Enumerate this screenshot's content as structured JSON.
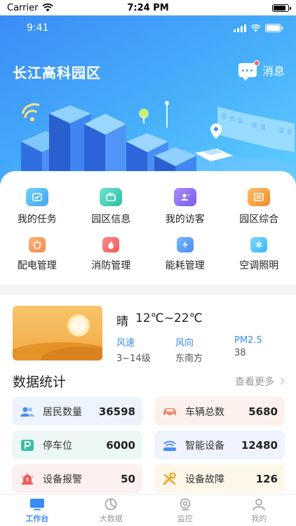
{
  "ios_status": {
    "carrier": "Carrier",
    "time": "7:24 PM"
  },
  "header": {
    "inner_time": "9:41",
    "title": "长江高科园区",
    "message_label": "消息"
  },
  "quick_menu": [
    {
      "label": "我的任务",
      "icon": "task-icon",
      "color": "#3fa7ec"
    },
    {
      "label": "园区信息",
      "icon": "park-info-icon",
      "color": "#2fbfa6"
    },
    {
      "label": "我的访客",
      "icon": "visitor-icon",
      "color": "#7a5af0"
    },
    {
      "label": "园区综合",
      "icon": "park-general-icon",
      "color": "#f08a2a"
    },
    {
      "label": "配电管理",
      "icon": "power-icon",
      "color": "#f5894a"
    },
    {
      "label": "消防管理",
      "icon": "fire-icon",
      "color": "#f15a5a"
    },
    {
      "label": "能耗管理",
      "icon": "energy-icon",
      "color": "#4a8cf5"
    },
    {
      "label": "空调照明",
      "icon": "ac-light-icon",
      "color": "#39b7f0"
    }
  ],
  "weather": {
    "condition": "晴",
    "temp": "12℃~22℃",
    "items": [
      {
        "key": "风速",
        "value": "3~14级"
      },
      {
        "key": "风向",
        "value": "东南方"
      },
      {
        "key": "PM2.5",
        "value": "38"
      }
    ]
  },
  "stats_section": {
    "title": "数据统计",
    "more_label": "查看更多"
  },
  "stats": [
    {
      "label": "居民数量",
      "value": "36598",
      "icon": "residents-icon",
      "bg": "#eef4fd",
      "color": "#4a8cf5"
    },
    {
      "label": "车辆总数",
      "value": "5680",
      "icon": "vehicle-icon",
      "bg": "#fdf1ee",
      "color": "#f08a6a"
    },
    {
      "label": "停车位",
      "value": "6000",
      "icon": "parking-icon",
      "bg": "#edf8f6",
      "color": "#36c1a4"
    },
    {
      "label": "智能设备",
      "value": "12480",
      "icon": "smart-device-icon",
      "bg": "#eef3fd",
      "color": "#4a8cf5"
    },
    {
      "label": "设备报警",
      "value": "50",
      "icon": "alarm-icon",
      "bg": "#fdf0f0",
      "color": "#f15a5a"
    },
    {
      "label": "设备故障",
      "value": "126",
      "icon": "fault-icon",
      "bg": "#fdf7ea",
      "color": "#f0a52a"
    }
  ],
  "tabs": [
    {
      "label": "工作台",
      "icon": "workbench-icon",
      "active": true
    },
    {
      "label": "大数据",
      "icon": "bigdata-icon",
      "active": false
    },
    {
      "label": "监控",
      "icon": "camera-icon",
      "active": false
    },
    {
      "label": "我的",
      "icon": "profile-icon",
      "active": false
    }
  ]
}
